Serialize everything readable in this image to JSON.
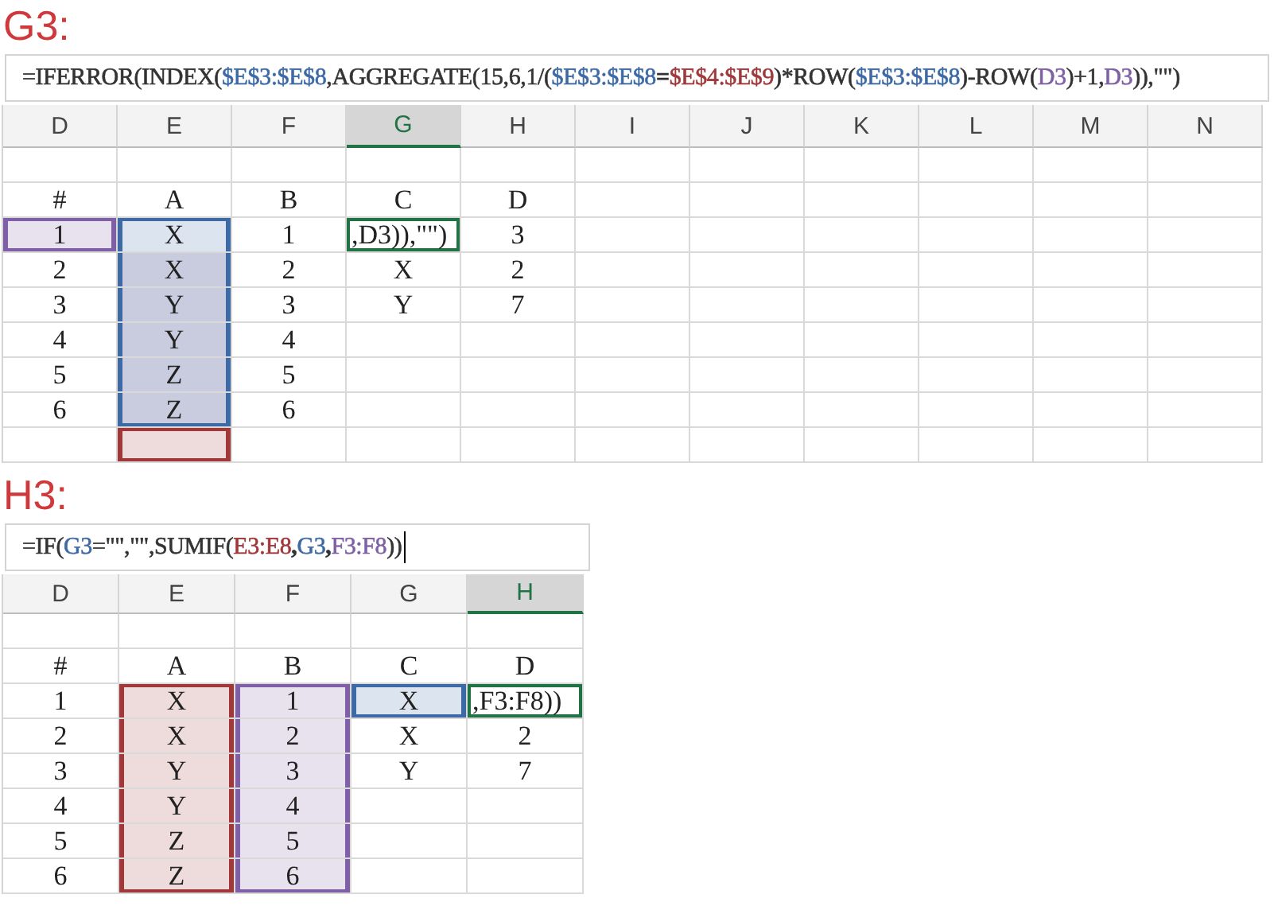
{
  "panels": [
    {
      "title": "G3:",
      "formula": {
        "cursor": false,
        "parts": [
          {
            "text": "=IFERROR(INDEX(",
            "color": "#333333"
          },
          {
            "text": "$E$3:$E$8",
            "color": "#3d6aa5"
          },
          {
            "text": ",AGGREGATE(15,6,1/(",
            "color": "#333333"
          },
          {
            "text": "$E$3:$E$8",
            "color": "#3d6aa5"
          },
          {
            "text": "=",
            "color": "#333333"
          },
          {
            "text": "$E$4:$E$9",
            "color": "#a0383a"
          },
          {
            "text": ")*ROW(",
            "color": "#333333"
          },
          {
            "text": "$E$3:$E$8",
            "color": "#3d6aa5"
          },
          {
            "text": ")-ROW(",
            "color": "#333333"
          },
          {
            "text": "D3",
            "color": "#7f5fa5"
          },
          {
            "text": ")+1,",
            "color": "#333333"
          },
          {
            "text": "D3",
            "color": "#7f5fa5"
          },
          {
            "text": ")),\"\")",
            "color": "#333333"
          }
        ]
      },
      "columns": [
        {
          "label": "D",
          "selected": false
        },
        {
          "label": "E",
          "selected": false
        },
        {
          "label": "F",
          "selected": false
        },
        {
          "label": "G",
          "selected": true
        },
        {
          "label": "H",
          "selected": false
        },
        {
          "label": "I",
          "selected": false
        },
        {
          "label": "J",
          "selected": false
        },
        {
          "label": "K",
          "selected": false
        },
        {
          "label": "L",
          "selected": false
        },
        {
          "label": "M",
          "selected": false
        },
        {
          "label": "N",
          "selected": false
        }
      ],
      "rows": [
        {
          "cells": [
            {
              "selected": false
            },
            {
              "selected": false
            },
            {
              "selected": false
            },
            {
              "selected": false
            },
            {
              "selected": false
            },
            {
              "selected": false
            },
            {
              "selected": false
            },
            {
              "selected": false
            },
            {
              "selected": false
            },
            {
              "selected": false
            },
            {
              "selected": false
            }
          ]
        },
        {
          "cells": [
            {
              "text": "#",
              "selected": false
            },
            {
              "text": "A",
              "selected": false
            },
            {
              "text": "B",
              "selected": false
            },
            {
              "text": "C",
              "selected": false
            },
            {
              "text": "D",
              "selected": false
            },
            {
              "selected": false
            },
            {
              "selected": false
            },
            {
              "selected": false
            },
            {
              "selected": false
            },
            {
              "selected": false
            },
            {
              "selected": false
            }
          ]
        },
        {
          "cells": [
            {
              "text": "1",
              "selected": false,
              "color": "#7f5fa5"
            },
            {
              "text": "X",
              "selected": false,
              "color": "#3d6aa5"
            },
            {
              "text": "1",
              "selected": false
            },
            {
              "text": ",D3)),\"\")",
              "selected": true
            },
            {
              "text": "3",
              "selected": false
            },
            {
              "selected": false
            },
            {
              "selected": false
            },
            {
              "selected": false
            },
            {
              "selected": false
            },
            {
              "selected": false
            },
            {
              "selected": false
            }
          ]
        },
        {
          "cells": [
            {
              "text": "2",
              "selected": false
            },
            {
              "text": "X",
              "selected": false,
              "color": "#3d6aa5",
              "overlap": true
            },
            {
              "text": "2",
              "selected": false
            },
            {
              "text": "X",
              "selected": false
            },
            {
              "text": "2",
              "selected": false
            },
            {
              "selected": false
            },
            {
              "selected": false
            },
            {
              "selected": false
            },
            {
              "selected": false
            },
            {
              "selected": false
            },
            {
              "selected": false
            }
          ]
        },
        {
          "cells": [
            {
              "text": "3",
              "selected": false
            },
            {
              "text": "Y",
              "selected": false,
              "color": "#3d6aa5",
              "overlap": true
            },
            {
              "text": "3",
              "selected": false
            },
            {
              "text": "Y",
              "selected": false
            },
            {
              "text": "7",
              "selected": false
            },
            {
              "selected": false
            },
            {
              "selected": false
            },
            {
              "selected": false
            },
            {
              "selected": false
            },
            {
              "selected": false
            },
            {
              "selected": false
            }
          ]
        },
        {
          "cells": [
            {
              "text": "4",
              "selected": false
            },
            {
              "text": "Y",
              "selected": false,
              "color": "#3d6aa5",
              "overlap": true
            },
            {
              "text": "4",
              "selected": false
            },
            {
              "selected": false
            },
            {
              "selected": false
            },
            {
              "selected": false
            },
            {
              "selected": false
            },
            {
              "selected": false
            },
            {
              "selected": false
            },
            {
              "selected": false
            },
            {
              "selected": false
            }
          ]
        },
        {
          "cells": [
            {
              "text": "5",
              "selected": false
            },
            {
              "text": "Z",
              "selected": false,
              "color": "#3d6aa5",
              "overlap": true
            },
            {
              "text": "5",
              "selected": false
            },
            {
              "selected": false
            },
            {
              "selected": false
            },
            {
              "selected": false
            },
            {
              "selected": false
            },
            {
              "selected": false
            },
            {
              "selected": false
            },
            {
              "selected": false
            },
            {
              "selected": false
            }
          ]
        },
        {
          "cells": [
            {
              "text": "6",
              "selected": false
            },
            {
              "text": "Z",
              "selected": false,
              "color": "#3d6aa5",
              "overlap": true
            },
            {
              "text": "6",
              "selected": false
            },
            {
              "selected": false
            },
            {
              "selected": false
            },
            {
              "selected": false
            },
            {
              "selected": false
            },
            {
              "selected": false
            },
            {
              "selected": false
            },
            {
              "selected": false
            },
            {
              "selected": false
            }
          ]
        },
        {
          "cells": [
            {
              "selected": false
            },
            {
              "selected": false,
              "color": "#a0383a"
            },
            {
              "selected": false
            },
            {
              "selected": false
            },
            {
              "selected": false
            },
            {
              "selected": false
            },
            {
              "selected": false
            },
            {
              "selected": false
            },
            {
              "selected": false
            },
            {
              "selected": false
            },
            {
              "selected": false
            }
          ]
        }
      ]
    },
    {
      "title": "H3:",
      "formula": {
        "cursor": true,
        "parts": [
          {
            "text": "=IF(",
            "color": "#333333"
          },
          {
            "text": "G3",
            "color": "#3d6aa5"
          },
          {
            "text": "=\"\",\"\",SUMIF(",
            "color": "#333333"
          },
          {
            "text": "E3:E8",
            "color": "#a0383a"
          },
          {
            "text": ",",
            "color": "#333333"
          },
          {
            "text": "G3",
            "color": "#3d6aa5"
          },
          {
            "text": ",",
            "color": "#333333"
          },
          {
            "text": "F3:F8",
            "color": "#7f5fa5"
          },
          {
            "text": "))",
            "color": "#333333"
          }
        ]
      },
      "columns": [
        {
          "label": "D",
          "selected": false
        },
        {
          "label": "E",
          "selected": false
        },
        {
          "label": "F",
          "selected": false
        },
        {
          "label": "G",
          "selected": false
        },
        {
          "label": "H",
          "selected": true
        }
      ],
      "rows": [
        {
          "cells": [
            {
              "selected": false
            },
            {
              "selected": false
            },
            {
              "selected": false
            },
            {
              "selected": false
            },
            {
              "selected": false
            }
          ]
        },
        {
          "cells": [
            {
              "text": "#",
              "selected": false
            },
            {
              "text": "A",
              "selected": false
            },
            {
              "text": "B",
              "selected": false
            },
            {
              "text": "C",
              "selected": false
            },
            {
              "text": "D",
              "selected": false
            }
          ]
        },
        {
          "cells": [
            {
              "text": "1",
              "selected": false
            },
            {
              "text": "X",
              "selected": false,
              "color": "#a0383a"
            },
            {
              "text": "1",
              "selected": false,
              "color": "#7f5fa5"
            },
            {
              "text": "X",
              "selected": false,
              "color": "#3d6aa5"
            },
            {
              "text": ",F3:F8))",
              "selected": true
            }
          ]
        },
        {
          "cells": [
            {
              "text": "2",
              "selected": false
            },
            {
              "text": "X",
              "selected": false,
              "color": "#a0383a"
            },
            {
              "text": "2",
              "selected": false,
              "color": "#7f5fa5"
            },
            {
              "text": "X",
              "selected": false
            },
            {
              "text": "2",
              "selected": false
            }
          ]
        },
        {
          "cells": [
            {
              "text": "3",
              "selected": false
            },
            {
              "text": "Y",
              "selected": false,
              "color": "#a0383a"
            },
            {
              "text": "3",
              "selected": false,
              "color": "#7f5fa5"
            },
            {
              "text": "Y",
              "selected": false
            },
            {
              "text": "7",
              "selected": false
            }
          ]
        },
        {
          "cells": [
            {
              "text": "4",
              "selected": false
            },
            {
              "text": "Y",
              "selected": false,
              "color": "#a0383a"
            },
            {
              "text": "4",
              "selected": false,
              "color": "#7f5fa5"
            },
            {
              "selected": false
            },
            {
              "selected": false
            }
          ]
        },
        {
          "cells": [
            {
              "text": "5",
              "selected": false
            },
            {
              "text": "Z",
              "selected": false,
              "color": "#a0383a"
            },
            {
              "text": "5",
              "selected": false,
              "color": "#7f5fa5"
            },
            {
              "selected": false
            },
            {
              "selected": false
            }
          ]
        },
        {
          "cells": [
            {
              "text": "6",
              "selected": false
            },
            {
              "text": "Z",
              "selected": false,
              "color": "#a0383a"
            },
            {
              "text": "6",
              "selected": false,
              "color": "#7f5fa5"
            },
            {
              "selected": false
            },
            {
              "selected": false
            }
          ]
        }
      ]
    }
  ]
}
